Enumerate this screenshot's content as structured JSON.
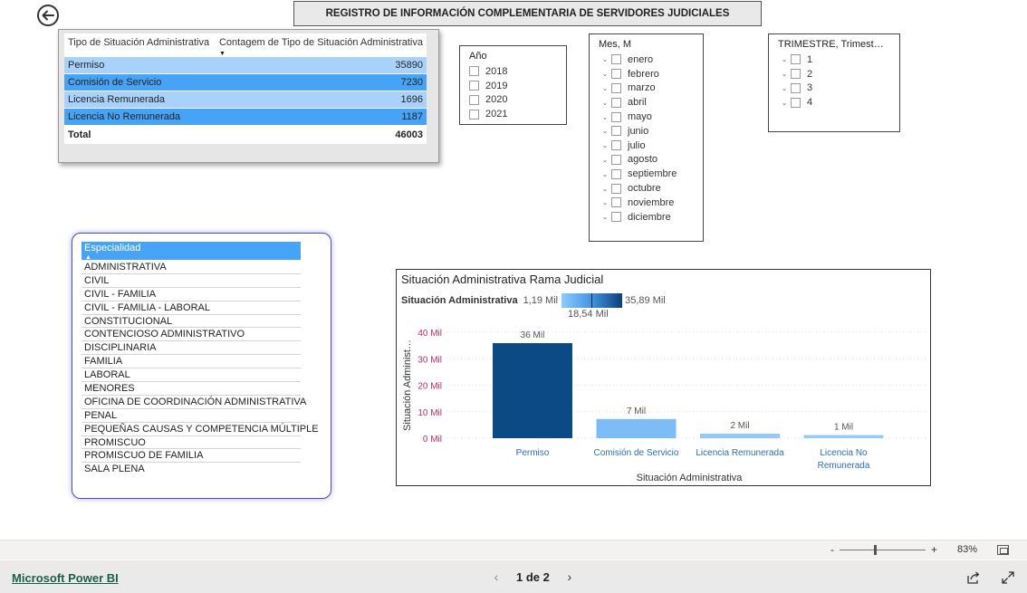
{
  "report": {
    "title": "REGISTRO DE INFORMACIÓN COMPLEMENTARIA DE SERVIDORES JUDICIALES"
  },
  "table": {
    "col1_header": "Tipo de Situación Administrativa",
    "col2_header": "Contagem de Tipo de Situación Administrativa",
    "rows": [
      {
        "label": "Permiso",
        "value": "35890"
      },
      {
        "label": "Comisión de Servicio",
        "value": "7230"
      },
      {
        "label": "Licencia Remunerada",
        "value": "1696"
      },
      {
        "label": "Licencia No Remunerada",
        "value": "1187"
      }
    ],
    "total_label": "Total",
    "total_value": "46003",
    "row_colors": {
      "light": "#a8d2fb",
      "dark": "#47a3f6"
    }
  },
  "year_slicer": {
    "header": "Año",
    "items": [
      "2018",
      "2019",
      "2020",
      "2021"
    ]
  },
  "month_slicer": {
    "header": "Mes, M",
    "items": [
      "enero",
      "febrero",
      "marzo",
      "abril",
      "mayo",
      "junio",
      "julio",
      "agosto",
      "septiembre",
      "octubre",
      "noviembre",
      "diciembre"
    ]
  },
  "quarter_slicer": {
    "header": "TRIMESTRE, Trimest…",
    "items": [
      "1",
      "2",
      "3",
      "4"
    ]
  },
  "especialidad": {
    "header": "Especialidad",
    "items": [
      "ADMINISTRATIVA",
      "CIVIL",
      "CIVIL - FAMILIA",
      "CIVIL - FAMILIA - LABORAL",
      "CONSTITUCIONAL",
      "CONTENCIOSO ADMINISTRATIVO",
      "DISCIPLINARIA",
      "FAMILIA",
      "LABORAL",
      "MENORES",
      "OFICINA DE COORDINACIÓN ADMINISTRATIVA",
      "PENAL",
      "PEQUEÑAS CAUSAS Y COMPETENCIA MÚLTIPLE",
      "PROMISCUO",
      "PROMISCUO DE FAMILIA",
      "SALA PLENA"
    ]
  },
  "chart": {
    "title": "Situación Administrativa Rama Judicial",
    "legend_label": "Situación Administrativa",
    "legend_min": "1,19 Mil",
    "legend_mid": "18,54 Mil",
    "legend_max": "35,89 Mil"
  },
  "chart_data": {
    "type": "bar",
    "title": "Situación Administrativa Rama Judicial",
    "categories": [
      "Permiso",
      "Comisión de Servicio",
      "Licencia Remunerada",
      "Licencia No Remunerada"
    ],
    "category_lines": [
      [
        "Permiso"
      ],
      [
        "Comisión de Servicio"
      ],
      [
        "Licencia Remunerada"
      ],
      [
        "Licencia No",
        "Remunerada"
      ]
    ],
    "values": [
      35890,
      7230,
      1696,
      1187
    ],
    "data_labels": [
      "36 Mil",
      "7 Mil",
      "2 Mil",
      "1 Mil"
    ],
    "colors": [
      "#0c4a86",
      "#7cbdf7",
      "#92c9fa",
      "#95cbfb"
    ],
    "xlabel": "Situación Administrativa",
    "ylabel": "Situación Administ…",
    "yticks": [
      0,
      10000,
      20000,
      30000,
      40000
    ],
    "ytick_labels": [
      "0 Mil",
      "10 Mil",
      "20 Mil",
      "30 Mil",
      "40 Mil"
    ],
    "ylim": [
      0,
      40000
    ],
    "grid": true,
    "tick_color": "#b5316a",
    "category_color": "#2e6db4"
  },
  "bottom": {
    "zoom_minus": "-",
    "zoom_plus": "+",
    "zoom_level": "83%",
    "brand": "Microsoft Power BI",
    "page_indicator": "1 de 2",
    "prev": "‹",
    "next": "›"
  }
}
